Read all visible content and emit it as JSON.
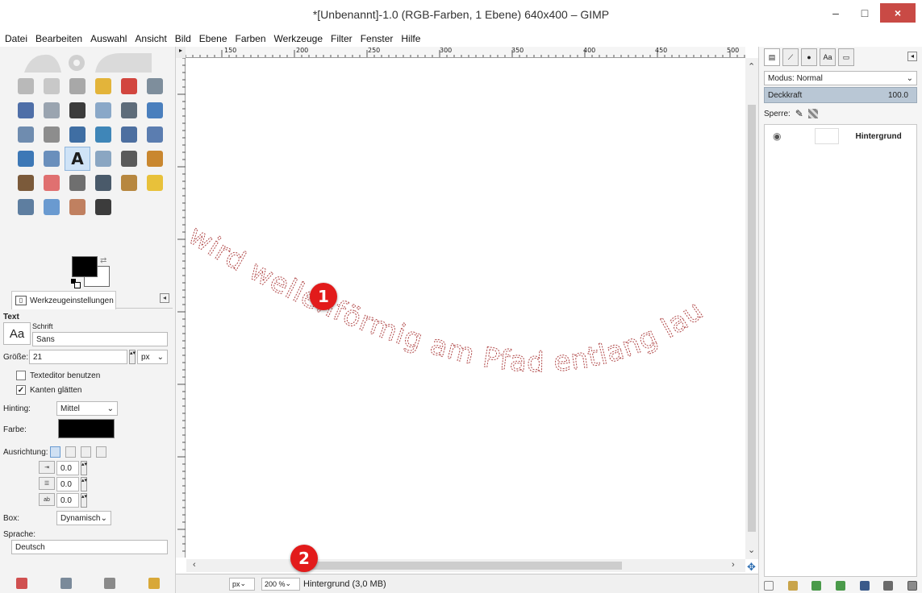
{
  "window": {
    "title": "*[Unbenannt]-1.0 (RGB-Farben, 1 Ebene) 640x400 – GIMP",
    "minimize": "–",
    "maximize": "□",
    "close": "×"
  },
  "menu": [
    "Datei",
    "Bearbeiten",
    "Auswahl",
    "Ansicht",
    "Bild",
    "Ebene",
    "Farben",
    "Werkzeuge",
    "Filter",
    "Fenster",
    "Hilfe"
  ],
  "toolbox": {
    "tools": [
      {
        "name": "rect-select-icon",
        "color": "#b9b9b9"
      },
      {
        "name": "ellipse-select-icon",
        "color": "#c8c8c8"
      },
      {
        "name": "free-select-icon",
        "color": "#a8a8a8"
      },
      {
        "name": "fuzzy-select-icon",
        "color": "#e3b43a"
      },
      {
        "name": "select-by-color-icon",
        "color": "#d2463f"
      },
      {
        "name": "scissors-select-icon",
        "color": "#7e8e9c"
      },
      {
        "name": "foreground-select-icon",
        "color": "#4f6fa8"
      },
      {
        "name": "paths-icon",
        "color": "#9aa4b0"
      },
      {
        "name": "color-picker-icon",
        "color": "#3b3b3b"
      },
      {
        "name": "zoom-icon",
        "color": "#8aa8c8"
      },
      {
        "name": "measure-icon",
        "color": "#5e6c7a"
      },
      {
        "name": "move-icon",
        "color": "#4a7fbd"
      },
      {
        "name": "align-icon",
        "color": "#6f8caf"
      },
      {
        "name": "crop-icon",
        "color": "#8d8d8d"
      },
      {
        "name": "rotate-icon",
        "color": "#3f6ea3"
      },
      {
        "name": "scale-icon",
        "color": "#3f86b8"
      },
      {
        "name": "shear-icon",
        "color": "#4d6fa0"
      },
      {
        "name": "perspective-icon",
        "color": "#5b7db0"
      },
      {
        "name": "flip-icon",
        "color": "#3d78b6"
      },
      {
        "name": "cage-transform-icon",
        "color": "#6a8fbc"
      },
      {
        "name": "text-tool-icon",
        "color": "#1c1c1c"
      },
      {
        "name": "bucket-fill-icon",
        "color": "#8aa6c2"
      },
      {
        "name": "blend-icon",
        "color": "#5a5a5a"
      },
      {
        "name": "pencil-icon",
        "color": "#c9872f"
      },
      {
        "name": "paintbrush-icon",
        "color": "#7b5a3a"
      },
      {
        "name": "eraser-icon",
        "color": "#e07070"
      },
      {
        "name": "airbrush-icon",
        "color": "#6f6f6f"
      },
      {
        "name": "ink-icon",
        "color": "#4a5a6a"
      },
      {
        "name": "clone-icon",
        "color": "#b7873f"
      },
      {
        "name": "heal-icon",
        "color": "#e8c13a"
      },
      {
        "name": "perspective-clone-icon",
        "color": "#5e7ea0"
      },
      {
        "name": "blur-icon",
        "color": "#6a9ad0"
      },
      {
        "name": "smudge-icon",
        "color": "#c08060"
      },
      {
        "name": "dodge-burn-icon",
        "color": "#3c3c3c"
      }
    ],
    "active_tool_glyph": "A",
    "options_tab_label": "Werkzeugeinstellungen",
    "options_title": "Text",
    "font_section_label": "Schrift",
    "font_preview": "Aa",
    "font_value": "Sans",
    "size_label": "Größe:",
    "size_value": "21",
    "size_unit": "px",
    "use_editor_label": "Texteditor benutzen",
    "antialias_label": "Kanten glätten",
    "antialias_checked": true,
    "hinting_label": "Hinting:",
    "hinting_value": "Mittel",
    "color_label": "Farbe:",
    "text_color": "#000000",
    "justify_label": "Ausrichtung:",
    "indent_value": "0.0",
    "line_spacing_value": "0.0",
    "letter_spacing_value": "0.0",
    "box_label": "Box:",
    "box_value": "Dynamisch",
    "language_label": "Sprache:",
    "language_value": "Deutsch"
  },
  "canvas": {
    "ruler_labels": [
      "150",
      "200",
      "250",
      "300",
      "350",
      "400",
      "450",
      "500"
    ],
    "path_text": "wird wellenförmig am Pfad entlang lau",
    "text_outline_color": "#b04848"
  },
  "statusbar": {
    "unit": "px",
    "zoom": "200 %",
    "info": "Hintergrund (3,0 MB)"
  },
  "callouts": [
    "1",
    "2"
  ],
  "layers_dock": {
    "mode_label": "Modus: Normal",
    "opacity_label": "Deckkraft",
    "opacity_value": "100.0",
    "lock_label": "Sperre:",
    "layer_name": "Hintergrund"
  },
  "accent_colors": {
    "badge": "#e21b1b",
    "close_button": "#c94a45",
    "opacity_bar": "#b9c7d5"
  }
}
